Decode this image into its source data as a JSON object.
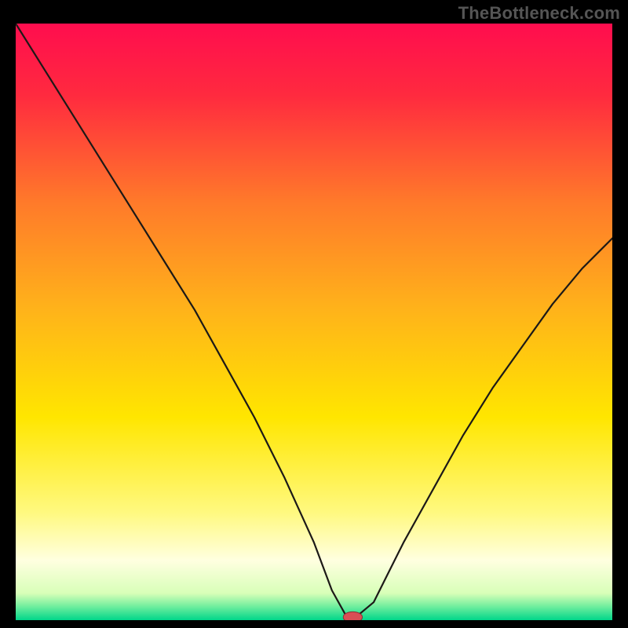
{
  "attribution": "TheBottleneck.com",
  "chart_data": {
    "type": "line",
    "title": "",
    "xlabel": "",
    "ylabel": "",
    "xlim": [
      0,
      100
    ],
    "ylim": [
      0,
      100
    ],
    "background_gradient": {
      "stops": [
        {
          "offset": 0.0,
          "color": "#ff0d4e"
        },
        {
          "offset": 0.12,
          "color": "#ff2a3f"
        },
        {
          "offset": 0.3,
          "color": "#ff7a2a"
        },
        {
          "offset": 0.48,
          "color": "#ffb31a"
        },
        {
          "offset": 0.66,
          "color": "#ffe600"
        },
        {
          "offset": 0.82,
          "color": "#fff980"
        },
        {
          "offset": 0.9,
          "color": "#ffffe0"
        },
        {
          "offset": 0.955,
          "color": "#d8ffb8"
        },
        {
          "offset": 0.975,
          "color": "#7af0a0"
        },
        {
          "offset": 1.0,
          "color": "#00d68a"
        }
      ]
    },
    "series": [
      {
        "name": "bottleneck-curve",
        "line_color": "#1c1917",
        "line_width": 2.2,
        "x": [
          0,
          5,
          10,
          15,
          20,
          25,
          30,
          35,
          40,
          45,
          50,
          53,
          55.5,
          57,
          60,
          62,
          65,
          70,
          75,
          80,
          85,
          90,
          95,
          100
        ],
        "y": [
          100,
          92,
          84,
          76,
          68,
          60,
          52,
          43,
          34,
          24,
          13,
          5,
          0.5,
          0.5,
          3,
          7,
          13,
          22,
          31,
          39,
          46,
          53,
          59,
          64
        ]
      }
    ],
    "marker": {
      "name": "optimal-point",
      "x": 56.5,
      "y": 0.5,
      "rx": 1.6,
      "ry": 0.9,
      "fill": "#da4e55",
      "stroke": "#8a2f35"
    }
  }
}
